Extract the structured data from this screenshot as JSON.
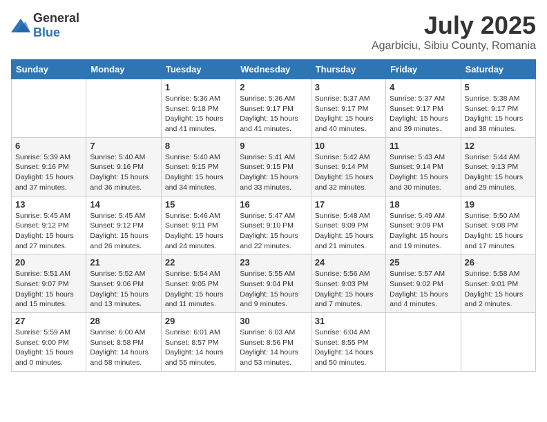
{
  "header": {
    "logo": {
      "general": "General",
      "blue": "Blue"
    },
    "month": "July 2025",
    "location": "Agarbiciu, Sibiu County, Romania"
  },
  "weekdays": [
    "Sunday",
    "Monday",
    "Tuesday",
    "Wednesday",
    "Thursday",
    "Friday",
    "Saturday"
  ],
  "weeks": [
    [
      {
        "day": "",
        "detail": ""
      },
      {
        "day": "",
        "detail": ""
      },
      {
        "day": "1",
        "detail": "Sunrise: 5:36 AM\nSunset: 9:18 PM\nDaylight: 15 hours\nand 41 minutes."
      },
      {
        "day": "2",
        "detail": "Sunrise: 5:36 AM\nSunset: 9:17 PM\nDaylight: 15 hours\nand 41 minutes."
      },
      {
        "day": "3",
        "detail": "Sunrise: 5:37 AM\nSunset: 9:17 PM\nDaylight: 15 hours\nand 40 minutes."
      },
      {
        "day": "4",
        "detail": "Sunrise: 5:37 AM\nSunset: 9:17 PM\nDaylight: 15 hours\nand 39 minutes."
      },
      {
        "day": "5",
        "detail": "Sunrise: 5:38 AM\nSunset: 9:17 PM\nDaylight: 15 hours\nand 38 minutes."
      }
    ],
    [
      {
        "day": "6",
        "detail": "Sunrise: 5:39 AM\nSunset: 9:16 PM\nDaylight: 15 hours\nand 37 minutes."
      },
      {
        "day": "7",
        "detail": "Sunrise: 5:40 AM\nSunset: 9:16 PM\nDaylight: 15 hours\nand 36 minutes."
      },
      {
        "day": "8",
        "detail": "Sunrise: 5:40 AM\nSunset: 9:15 PM\nDaylight: 15 hours\nand 34 minutes."
      },
      {
        "day": "9",
        "detail": "Sunrise: 5:41 AM\nSunset: 9:15 PM\nDaylight: 15 hours\nand 33 minutes."
      },
      {
        "day": "10",
        "detail": "Sunrise: 5:42 AM\nSunset: 9:14 PM\nDaylight: 15 hours\nand 32 minutes."
      },
      {
        "day": "11",
        "detail": "Sunrise: 5:43 AM\nSunset: 9:14 PM\nDaylight: 15 hours\nand 30 minutes."
      },
      {
        "day": "12",
        "detail": "Sunrise: 5:44 AM\nSunset: 9:13 PM\nDaylight: 15 hours\nand 29 minutes."
      }
    ],
    [
      {
        "day": "13",
        "detail": "Sunrise: 5:45 AM\nSunset: 9:12 PM\nDaylight: 15 hours\nand 27 minutes."
      },
      {
        "day": "14",
        "detail": "Sunrise: 5:45 AM\nSunset: 9:12 PM\nDaylight: 15 hours\nand 26 minutes."
      },
      {
        "day": "15",
        "detail": "Sunrise: 5:46 AM\nSunset: 9:11 PM\nDaylight: 15 hours\nand 24 minutes."
      },
      {
        "day": "16",
        "detail": "Sunrise: 5:47 AM\nSunset: 9:10 PM\nDaylight: 15 hours\nand 22 minutes."
      },
      {
        "day": "17",
        "detail": "Sunrise: 5:48 AM\nSunset: 9:09 PM\nDaylight: 15 hours\nand 21 minutes."
      },
      {
        "day": "18",
        "detail": "Sunrise: 5:49 AM\nSunset: 9:09 PM\nDaylight: 15 hours\nand 19 minutes."
      },
      {
        "day": "19",
        "detail": "Sunrise: 5:50 AM\nSunset: 9:08 PM\nDaylight: 15 hours\nand 17 minutes."
      }
    ],
    [
      {
        "day": "20",
        "detail": "Sunrise: 5:51 AM\nSunset: 9:07 PM\nDaylight: 15 hours\nand 15 minutes."
      },
      {
        "day": "21",
        "detail": "Sunrise: 5:52 AM\nSunset: 9:06 PM\nDaylight: 15 hours\nand 13 minutes."
      },
      {
        "day": "22",
        "detail": "Sunrise: 5:54 AM\nSunset: 9:05 PM\nDaylight: 15 hours\nand 11 minutes."
      },
      {
        "day": "23",
        "detail": "Sunrise: 5:55 AM\nSunset: 9:04 PM\nDaylight: 15 hours\nand 9 minutes."
      },
      {
        "day": "24",
        "detail": "Sunrise: 5:56 AM\nSunset: 9:03 PM\nDaylight: 15 hours\nand 7 minutes."
      },
      {
        "day": "25",
        "detail": "Sunrise: 5:57 AM\nSunset: 9:02 PM\nDaylight: 15 hours\nand 4 minutes."
      },
      {
        "day": "26",
        "detail": "Sunrise: 5:58 AM\nSunset: 9:01 PM\nDaylight: 15 hours\nand 2 minutes."
      }
    ],
    [
      {
        "day": "27",
        "detail": "Sunrise: 5:59 AM\nSunset: 9:00 PM\nDaylight: 15 hours\nand 0 minutes."
      },
      {
        "day": "28",
        "detail": "Sunrise: 6:00 AM\nSunset: 8:58 PM\nDaylight: 14 hours\nand 58 minutes."
      },
      {
        "day": "29",
        "detail": "Sunrise: 6:01 AM\nSunset: 8:57 PM\nDaylight: 14 hours\nand 55 minutes."
      },
      {
        "day": "30",
        "detail": "Sunrise: 6:03 AM\nSunset: 8:56 PM\nDaylight: 14 hours\nand 53 minutes."
      },
      {
        "day": "31",
        "detail": "Sunrise: 6:04 AM\nSunset: 8:55 PM\nDaylight: 14 hours\nand 50 minutes."
      },
      {
        "day": "",
        "detail": ""
      },
      {
        "day": "",
        "detail": ""
      }
    ]
  ]
}
